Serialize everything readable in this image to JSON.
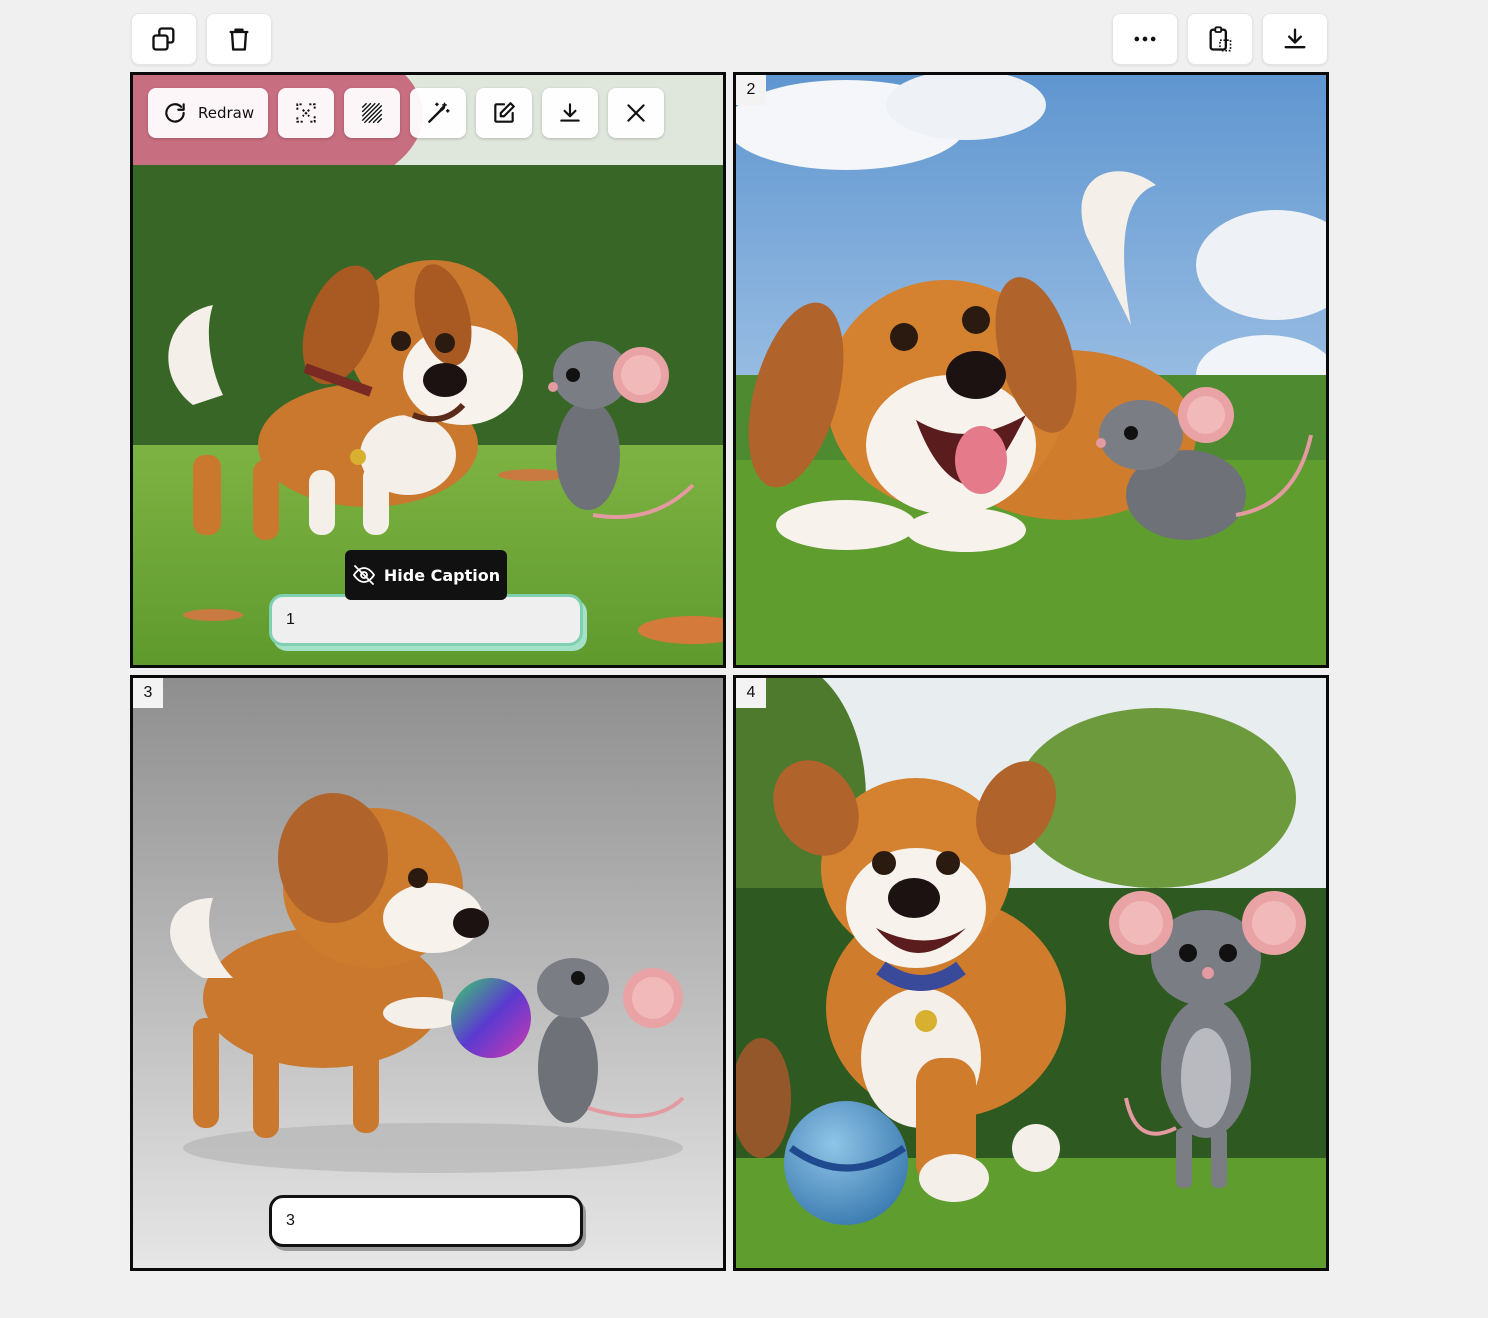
{
  "toolbar": {
    "left": [
      {
        "name": "duplicate-button",
        "icon": "copy-icon"
      },
      {
        "name": "delete-button",
        "icon": "trash-icon"
      }
    ],
    "right": [
      {
        "name": "more-options-button",
        "icon": "more-horizontal-icon"
      },
      {
        "name": "paste-button",
        "icon": "clipboard-icon"
      },
      {
        "name": "download-all-button",
        "icon": "download-icon"
      }
    ]
  },
  "image_toolbar": {
    "redraw_label": "Redraw",
    "buttons": [
      "redraw-icon",
      "expand-icon",
      "pattern-icon",
      "magic-wand-icon",
      "edit-icon",
      "download-icon",
      "close-icon"
    ]
  },
  "hide_caption": {
    "label": "Hide Caption"
  },
  "panels": [
    {
      "number": "1",
      "caption": "1"
    },
    {
      "number": "2",
      "caption": ""
    },
    {
      "number": "3",
      "caption": "3"
    },
    {
      "number": "4",
      "caption": ""
    }
  ],
  "colors": {
    "background": "#f0f0f0",
    "panel_border": "#0a0a0a",
    "caption_active_border": "#7fd0b0",
    "tooltip_bg": "#111111"
  }
}
